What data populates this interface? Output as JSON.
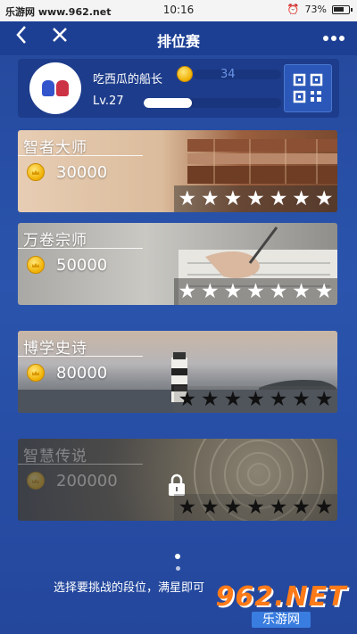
{
  "status_bar": {
    "carrier": "乐游网 www.962.net",
    "time": "10:16",
    "battery": "73%"
  },
  "nav": {
    "title": "排位赛",
    "back_icon": "chevron-left-icon",
    "close_icon": "close-icon",
    "more_icon": "more-dots-icon"
  },
  "profile": {
    "username": "吃西瓜的船长",
    "coins": "34",
    "level": "Lv.27",
    "exp_fraction": 0.35,
    "qr_icon": "qr-code-icon"
  },
  "ranks": [
    {
      "title": "智者大师",
      "cost": "30000",
      "stars": 7,
      "earned": 7,
      "locked": false
    },
    {
      "title": "万卷宗师",
      "cost": "50000",
      "stars": 7,
      "earned": 7,
      "locked": false
    },
    {
      "title": "博学史诗",
      "cost": "80000",
      "stars": 7,
      "earned": 0,
      "locked": false
    },
    {
      "title": "智慧传说",
      "cost": "200000",
      "stars": 7,
      "earned": 0,
      "locked": true
    }
  ],
  "pager": {
    "pages": 2,
    "active": 0
  },
  "footer": {
    "text": "选择要挑战的段位，满星即可"
  },
  "watermark": {
    "top": "962.NET",
    "bottom": "乐游网"
  },
  "colors": {
    "nav_bg": "#1c3f94",
    "accent_coin": "#f0b000",
    "bg": "#2a54ad"
  }
}
